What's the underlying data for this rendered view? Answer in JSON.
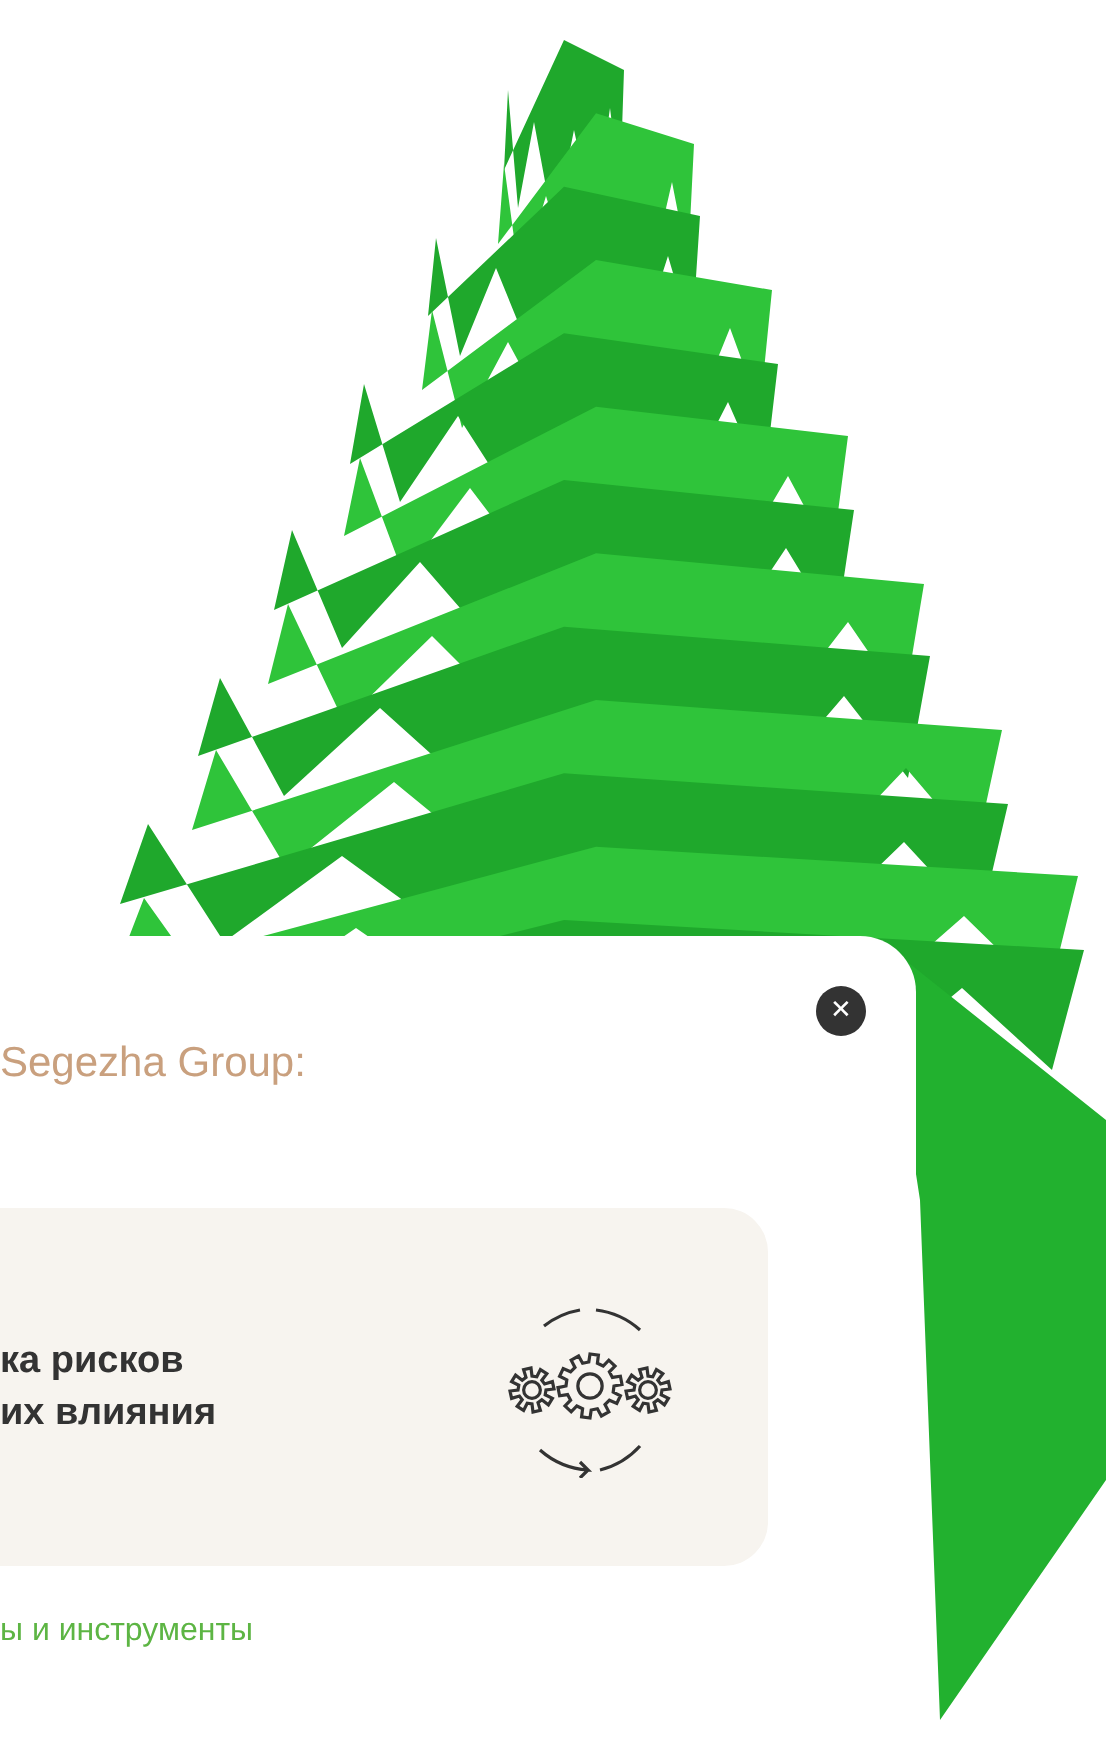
{
  "card": {
    "close": "✕",
    "title": "Segezha Group:",
    "feature": {
      "lines": [
        "ка рисков",
        "их влияния"
      ]
    },
    "section_heading": "ы и инструменты"
  }
}
